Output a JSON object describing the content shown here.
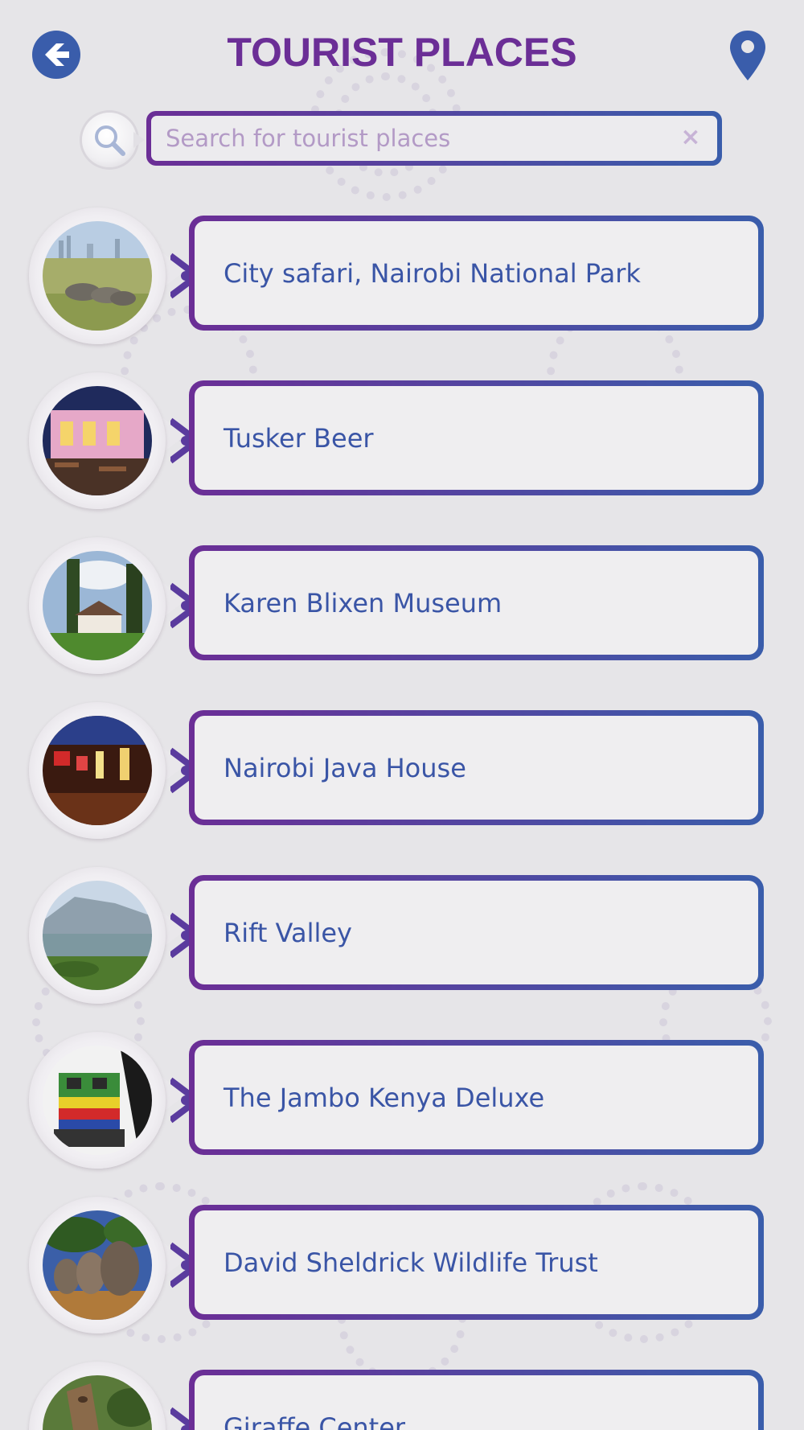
{
  "header": {
    "title": "TOURIST PLACES",
    "back_icon": "back-arrow-icon",
    "location_icon": "map-pin-icon"
  },
  "search": {
    "placeholder": "Search for tourist places",
    "value": "",
    "clear_label": "×",
    "icon": "search-icon"
  },
  "colors": {
    "title": "#6b2e96",
    "accent_blue": "#3a5dab",
    "label_text": "#3a55a6",
    "background": "#e6e5e8"
  },
  "places": [
    {
      "label": "City safari, Nairobi National Park",
      "thumbnail": "rhinos-savanna"
    },
    {
      "label": "Tusker Beer",
      "thumbnail": "lit-restaurant-night"
    },
    {
      "label": "Karen Blixen Museum",
      "thumbnail": "colonial-house-trees"
    },
    {
      "label": "Nairobi Java House",
      "thumbnail": "cafe-interior-lamps"
    },
    {
      "label": "Rift Valley",
      "thumbnail": "valley-landscape"
    },
    {
      "label": "The Jambo Kenya Deluxe",
      "thumbnail": "green-train"
    },
    {
      "label": "David Sheldrick Wildlife Trust",
      "thumbnail": "elephants"
    },
    {
      "label": "Giraffe Center",
      "thumbnail": "giraffe"
    }
  ]
}
